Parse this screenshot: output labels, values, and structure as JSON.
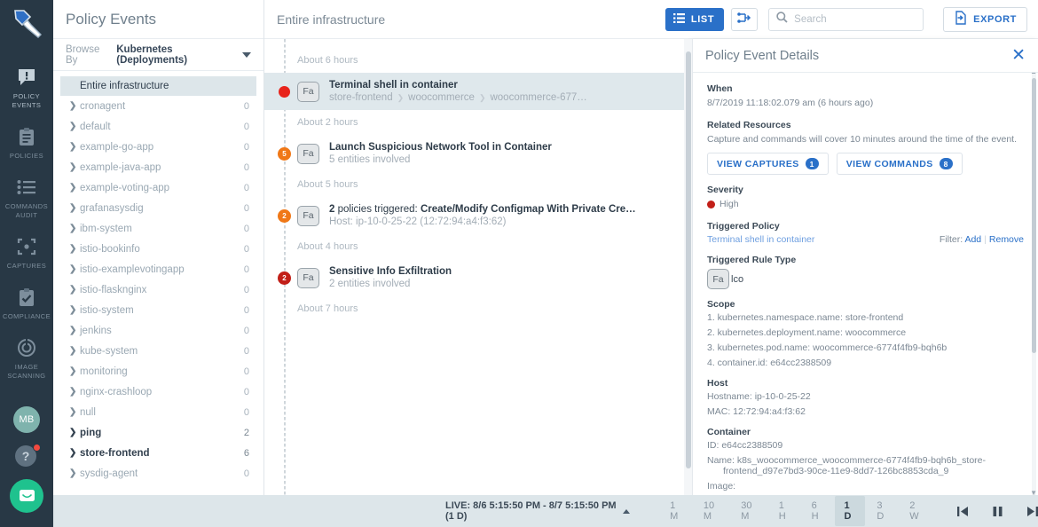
{
  "rail": {
    "logo_icon": "sysdig-shovel-logo",
    "items": [
      {
        "label": "POLICY\nEVENTS",
        "icon": "alert-bubble-icon",
        "active": true
      },
      {
        "label": "POLICIES",
        "icon": "clipboard-icon",
        "active": false
      },
      {
        "label": "COMMANDS\nAUDIT",
        "icon": "list-icon",
        "active": false
      },
      {
        "label": "CAPTURES",
        "icon": "capture-frame-icon",
        "active": false
      },
      {
        "label": "COMPLIANCE",
        "icon": "clipboard-check-icon",
        "active": false
      },
      {
        "label": "IMAGE\nSCANNING",
        "icon": "scan-target-icon",
        "active": false
      }
    ],
    "avatar_initials": "MB",
    "help_icon": "question-mark-icon",
    "chat_icon": "chat-bubble-icon"
  },
  "browse": {
    "title": "Policy Events",
    "browse_by_prefix": "Browse By",
    "browse_by_value": "Kubernetes (Deployments)",
    "root": {
      "label": "Entire infrastructure"
    },
    "items": [
      {
        "name": "cronagent",
        "count": "0",
        "bold": false
      },
      {
        "name": "default",
        "count": "0",
        "bold": false
      },
      {
        "name": "example-go-app",
        "count": "0",
        "bold": false
      },
      {
        "name": "example-java-app",
        "count": "0",
        "bold": false
      },
      {
        "name": "example-voting-app",
        "count": "0",
        "bold": false
      },
      {
        "name": "grafanasysdig",
        "count": "0",
        "bold": false
      },
      {
        "name": "ibm-system",
        "count": "0",
        "bold": false
      },
      {
        "name": "istio-bookinfo",
        "count": "0",
        "bold": false
      },
      {
        "name": "istio-examplevotingapp",
        "count": "0",
        "bold": false
      },
      {
        "name": "istio-flasknginx",
        "count": "0",
        "bold": false
      },
      {
        "name": "istio-system",
        "count": "0",
        "bold": false
      },
      {
        "name": "jenkins",
        "count": "0",
        "bold": false
      },
      {
        "name": "kube-system",
        "count": "0",
        "bold": false
      },
      {
        "name": "monitoring",
        "count": "0",
        "bold": false
      },
      {
        "name": "nginx-crashloop",
        "count": "0",
        "bold": false
      },
      {
        "name": "null",
        "count": "0",
        "bold": false
      },
      {
        "name": "ping",
        "count": "2",
        "bold": true
      },
      {
        "name": "store-frontend",
        "count": "6",
        "bold": true
      },
      {
        "name": "sysdig-agent",
        "count": "0",
        "bold": false
      }
    ]
  },
  "center": {
    "scope_title": "Entire infrastructure",
    "toolbar": {
      "list_label": "LIST",
      "list_icon": "list-view-icon",
      "graph_icon": "topology-graph-icon",
      "search_placeholder": "Search",
      "search_value": "",
      "search_icon": "search-icon",
      "export_label": "EXPORT",
      "export_icon": "export-file-icon"
    },
    "timeline": [
      {
        "kind": "gap",
        "label": "About 6 hours"
      },
      {
        "kind": "event",
        "selected": true,
        "badge": {
          "text": "",
          "color": "#e8241c",
          "shape": "dot"
        },
        "rule_badge": "Fa",
        "title": "Terminal shell in container",
        "title_prefix": "",
        "subtitle_parts": [
          "store-frontend",
          "woocommerce",
          "woocommerce-677…"
        ],
        "subtitle": "",
        "reel_icon": "capture-reel-icon"
      },
      {
        "kind": "gap",
        "label": "About 2 hours"
      },
      {
        "kind": "event",
        "selected": false,
        "badge": {
          "text": "5",
          "color": "#f07817",
          "shape": "count"
        },
        "rule_badge": "Fa",
        "title": "Launch Suspicious Network Tool in Container",
        "title_prefix": "",
        "subtitle_parts": [],
        "subtitle": "5 entities involved",
        "reel_icon": ""
      },
      {
        "kind": "gap",
        "label": "About 5 hours"
      },
      {
        "kind": "event",
        "selected": false,
        "badge": {
          "text": "2",
          "color": "#f07817",
          "shape": "count"
        },
        "rule_badge": "Fa",
        "title": "Create/Modify Configmap With Private Cre…",
        "title_prefix": "2 policies triggered:",
        "subtitle_parts": [],
        "subtitle": "Host: ip-10-0-25-22 (12:72:94:a4:f3:62)",
        "reel_icon": ""
      },
      {
        "kind": "gap",
        "label": "About 4 hours"
      },
      {
        "kind": "event",
        "selected": false,
        "badge": {
          "text": "2",
          "color": "#c21f18",
          "shape": "count"
        },
        "rule_badge": "Fa",
        "title": "Sensitive Info Exfiltration",
        "title_prefix": "",
        "subtitle_parts": [],
        "subtitle": "2 entities involved",
        "reel_icon": "capture-reel-icon"
      },
      {
        "kind": "gap",
        "label": "About 7 hours"
      }
    ]
  },
  "details": {
    "title": "Policy Event Details",
    "close_icon": "close-icon",
    "when_label": "When",
    "when_value": "8/7/2019 11:18:02.079 am (6 hours ago)",
    "related_label": "Related Resources",
    "related_note": "Capture and commands will cover 10 minutes around the time of the event.",
    "view_captures_label": "VIEW CAPTURES",
    "view_captures_count": "1",
    "view_commands_label": "VIEW COMMANDS",
    "view_commands_count": "8",
    "severity_label": "Severity",
    "severity_value": "High",
    "severity_color": "#c21f18",
    "policy_label": "Triggered Policy",
    "policy_value": "Terminal shell in container",
    "filter_label": "Filter:",
    "filter_add": "Add",
    "filter_remove": "Remove",
    "rule_type_label": "Triggered Rule Type",
    "rule_type_badge": "Fa",
    "rule_type_value": "lco",
    "scope_label": "Scope",
    "scope_items": [
      "1. kubernetes.namespace.name: store-frontend",
      "2. kubernetes.deployment.name: woocommerce",
      "3. kubernetes.pod.name: woocommerce-6774f4fb9-bqh6b",
      "4. container.id: e64cc2388509"
    ],
    "host_label": "Host",
    "host_name": "Hostname: ip-10-0-25-22",
    "host_mac": "MAC: 12:72:94:a4:f3:62",
    "container_label": "Container",
    "container_id": "ID: e64cc2388509",
    "container_name_line1": "Name: k8s_woocommerce_woocommerce-6774f4fb9-bqh6b_store-",
    "container_name_line2": "frontend_d97e7bd3-90ce-11e9-8dd7-126bc8853cda_9",
    "image_label": "Image:"
  },
  "timebar": {
    "live_label": "LIVE: 8/6 5:15:50 PM - 8/7 5:15:50 PM (1 D)",
    "ranges": [
      {
        "label": "1 M",
        "active": false
      },
      {
        "label": "10 M",
        "active": false
      },
      {
        "label": "30 M",
        "active": false
      },
      {
        "label": "1 H",
        "active": false
      },
      {
        "label": "6 H",
        "active": false
      },
      {
        "label": "1 D",
        "active": true
      },
      {
        "label": "3 D",
        "active": false
      },
      {
        "label": "2 W",
        "active": false
      }
    ],
    "controls": [
      {
        "icon": "skip-back-icon"
      },
      {
        "icon": "pause-icon"
      },
      {
        "icon": "skip-forward-icon"
      }
    ]
  }
}
